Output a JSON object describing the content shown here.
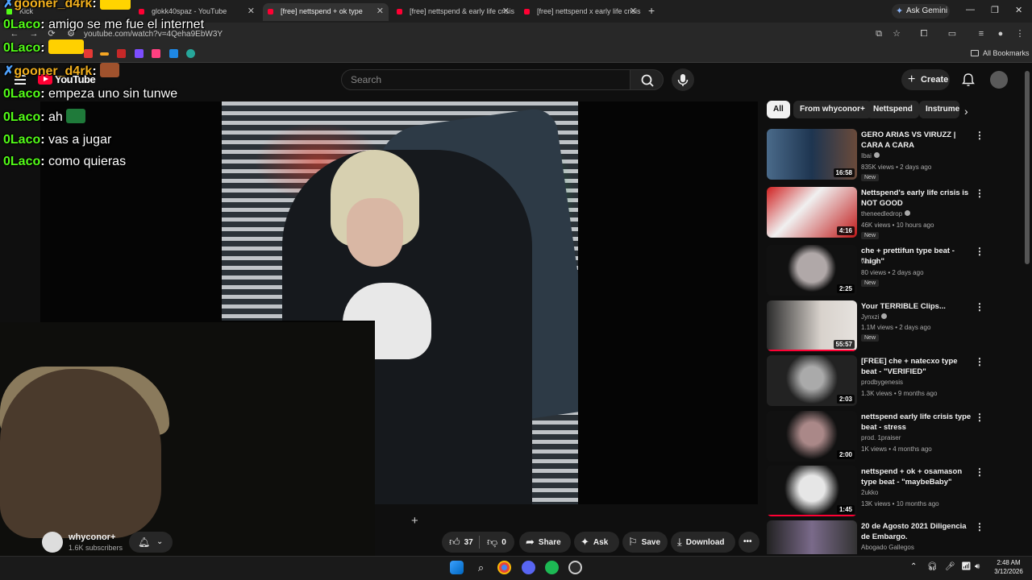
{
  "browser": {
    "tabs": [
      {
        "title": "Kick"
      },
      {
        "title": "glokk40spaz - YouTube"
      },
      {
        "title": "[free] nettspend + ok type"
      },
      {
        "title": "[free] nettspend & early life crisis"
      },
      {
        "title": "[free] nettspend x early life crisis"
      }
    ],
    "gemini_label": "Ask Gemini",
    "url": "youtube.com/watch?v=4Qeha9EbW3Y",
    "all_bookmarks": "All Bookmarks"
  },
  "youtube": {
    "logo_text": "YouTube",
    "search_placeholder": "Search",
    "create_label": "Create"
  },
  "chat": [
    {
      "user": "gooner_d4rk",
      "text": ""
    },
    {
      "user": "0Laco",
      "text": "amigo se me fue el internet"
    },
    {
      "user": "0Laco",
      "text": ""
    },
    {
      "user": "gooner_d4rk",
      "text": ""
    },
    {
      "user": "0Laco",
      "text": "empeza uno sin tunwe"
    },
    {
      "user": "0Laco",
      "text": "ah"
    },
    {
      "user": "0Laco",
      "text": "vas a jugar"
    },
    {
      "user": "0Laco",
      "text": "como quieras"
    }
  ],
  "channel": {
    "name": "whyconor+",
    "subscribers": "1.6K subscribers"
  },
  "actions": {
    "likes": "37",
    "dislikes": "0",
    "share": "Share",
    "ask": "Ask",
    "save": "Save",
    "download": "Download"
  },
  "chips": [
    "All",
    "From whyconor+",
    "Nettspend",
    "Instrumentals"
  ],
  "recommendations": [
    {
      "title": "GERO ARIAS VS VIRUZZ | CARA A CARA",
      "channel": "Ibai",
      "meta": "835K views • 2 days ago",
      "duration": "16:58",
      "badge": "New"
    },
    {
      "title": "Nettspend's early life crisis is NOT GOOD",
      "channel": "theneedledrop",
      "meta": "46K views • 10 hours ago",
      "duration": "4:16",
      "badge": "New"
    },
    {
      "title": "che + prettifun type beat - \"high\"",
      "channel": "wisior",
      "meta": "80 views • 2 days ago",
      "duration": "2:25",
      "badge": "New"
    },
    {
      "title": "Your TERRIBLE Clips...",
      "channel": "Jynxzi",
      "meta": "1.1M views • 2 days ago",
      "duration": "55:57",
      "badge": "New"
    },
    {
      "title": "[FREE] che + natecxo type beat - \"VERIFIED\"",
      "channel": "prodbygenesis",
      "meta": "1.3K views • 9 months ago",
      "duration": "2:03",
      "badge": ""
    },
    {
      "title": "nettspend early life crisis type beat - stress",
      "channel": "prod. 1praiser",
      "meta": "1K views • 4 months ago",
      "duration": "2:00",
      "badge": ""
    },
    {
      "title": "nettspend + ok + osamason type beat - \"maybeBaby\"",
      "channel": "2ukko",
      "meta": "13K views • 10 months ago",
      "duration": "1:45",
      "badge": ""
    },
    {
      "title": "20 de Agosto 2021 Diligencia de Embargo.",
      "channel": "Abogado Gallegos",
      "meta": "",
      "duration": "",
      "badge": ""
    }
  ],
  "taskbar": {
    "time": "2:48 AM",
    "date": "3/12/2026"
  },
  "colors": {
    "yt_red": "#ff0033",
    "kick_green": "#53fc18",
    "bg": "#0f0f0f"
  }
}
